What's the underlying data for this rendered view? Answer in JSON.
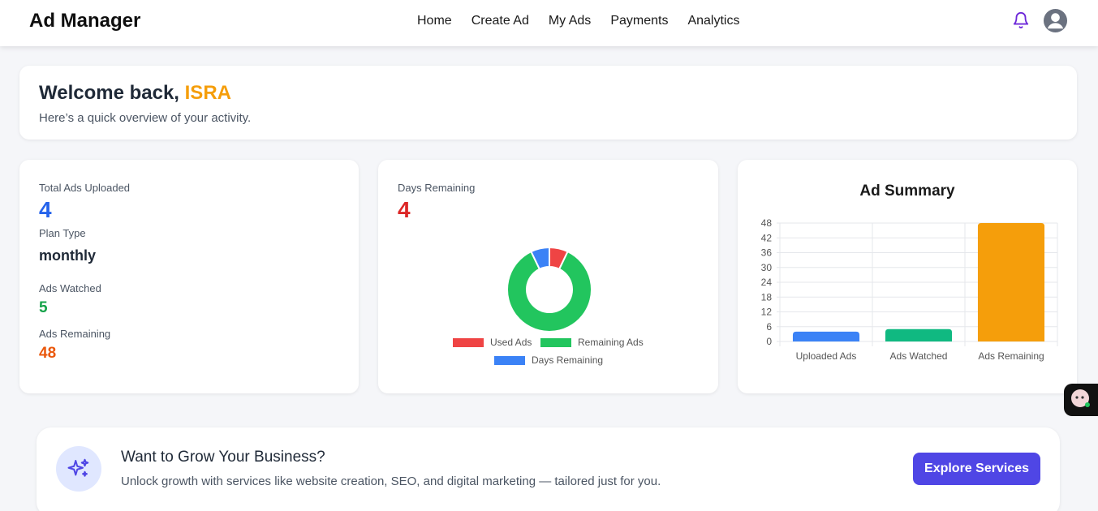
{
  "header": {
    "brand": "Ad Manager",
    "nav": [
      "Home",
      "Create Ad",
      "My Ads",
      "Payments",
      "Analytics"
    ],
    "icons": {
      "notification": "bell-icon",
      "profile": "user-avatar-icon"
    },
    "accent_color": "#6d28d9"
  },
  "welcome": {
    "greeting": "Welcome back,",
    "name": "ISRA",
    "subtitle": "Here’s a quick overview of your activity."
  },
  "stats": {
    "total_ads_label": "Total Ads Uploaded",
    "total_ads_value": "4",
    "plan_label": "Plan Type",
    "plan_value": "monthly",
    "watched_label": "Ads Watched",
    "watched_value": "5",
    "remaining_label": "Ads Remaining",
    "remaining_value": "48",
    "colors": {
      "total": "#2563eb",
      "watched": "#16a34a",
      "remaining": "#ea580c"
    }
  },
  "days": {
    "label": "Days Remaining",
    "value": "4",
    "value_color": "#dc2626"
  },
  "chart_data": [
    {
      "type": "pie",
      "variant": "doughnut",
      "labels": [
        "Used Ads",
        "Remaining Ads",
        "Days Remaining"
      ],
      "values": [
        4,
        48,
        4
      ],
      "colors": [
        "#ef4444",
        "#22c55e",
        "#3b82f6"
      ],
      "legend": "bottom"
    },
    {
      "type": "bar",
      "title": "Ad Summary",
      "categories": [
        "Uploaded Ads",
        "Ads Watched",
        "Ads Remaining"
      ],
      "values": [
        4,
        5,
        48
      ],
      "colors": [
        "#3b82f6",
        "#10b981",
        "#f59e0b"
      ],
      "ylim": [
        0,
        48
      ],
      "yticks": [
        0,
        6,
        12,
        18,
        24,
        30,
        36,
        42,
        48
      ],
      "grid": true
    }
  ],
  "promo": {
    "title": "Want to Grow Your Business?",
    "text": "Unlock growth with services like website creation, SEO, and digital marketing — tailored just for you.",
    "button": "Explore Services",
    "icon": "sparkles-icon"
  }
}
